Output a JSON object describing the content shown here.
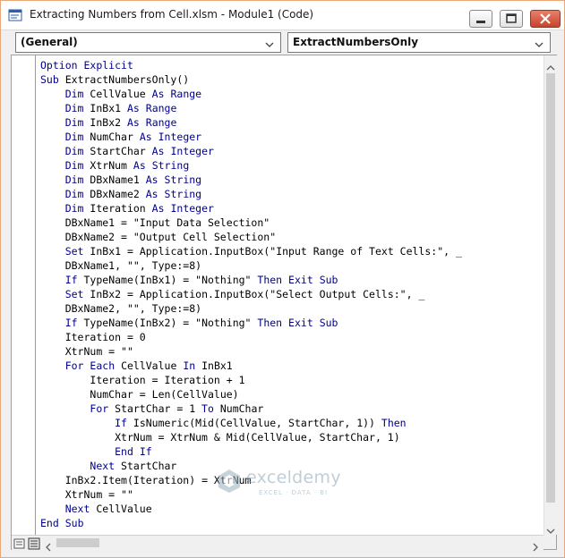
{
  "window": {
    "title": "Extracting Numbers from Cell.xlsm - Module1 (Code)"
  },
  "dropdowns": {
    "object": "(General)",
    "procedure": "ExtractNumbersOnly"
  },
  "code_lines": [
    "Option Explicit",
    "Sub ExtractNumbersOnly()",
    "    Dim CellValue As Range",
    "    Dim InBx1 As Range",
    "    Dim InBx2 As Range",
    "    Dim NumChar As Integer",
    "    Dim StartChar As Integer",
    "    Dim XtrNum As String",
    "    Dim DBxName1 As String",
    "    Dim DBxName2 As String",
    "    Dim Iteration As Integer",
    "    DBxName1 = \"Input Data Selection\"",
    "    DBxName2 = \"Output Cell Selection\"",
    "    Set InBx1 = Application.InputBox(\"Input Range of Text Cells:\", _",
    "    DBxName1, \"\", Type:=8)",
    "    If TypeName(InBx1) = \"Nothing\" Then Exit Sub",
    "    Set InBx2 = Application.InputBox(\"Select Output Cells:\", _",
    "    DBxName2, \"\", Type:=8)",
    "    If TypeName(InBx2) = \"Nothing\" Then Exit Sub",
    "    Iteration = 0",
    "    XtrNum = \"\"",
    "    For Each CellValue In InBx1",
    "        Iteration = Iteration + 1",
    "        NumChar = Len(CellValue)",
    "        For StartChar = 1 To NumChar",
    "            If IsNumeric(Mid(CellValue, StartChar, 1)) Then",
    "            XtrNum = XtrNum & Mid(CellValue, StartChar, 1)",
    "            End If",
    "        Next StartChar",
    "    InBx2.Item(Iteration) = XtrNum",
    "    XtrNum = \"\"",
    "    Next CellValue",
    "End Sub"
  ],
  "keywords": [
    "Option",
    "Explicit",
    "Sub",
    "Dim",
    "As",
    "Range",
    "Integer",
    "String",
    "Set",
    "If",
    "Then",
    "Exit",
    "For",
    "Each",
    "In",
    "To",
    "Next",
    "End"
  ],
  "colors": {
    "keyword": "#00008b",
    "text": "#000000",
    "window_border": "#e8a87a"
  },
  "watermark": {
    "name": "exceldemy",
    "tagline": "EXCEL · DATA · BI"
  },
  "icons": {
    "app": "vba-module-icon",
    "minimize": "minimize-icon",
    "maximize": "maximize-icon",
    "close": "close-icon"
  }
}
